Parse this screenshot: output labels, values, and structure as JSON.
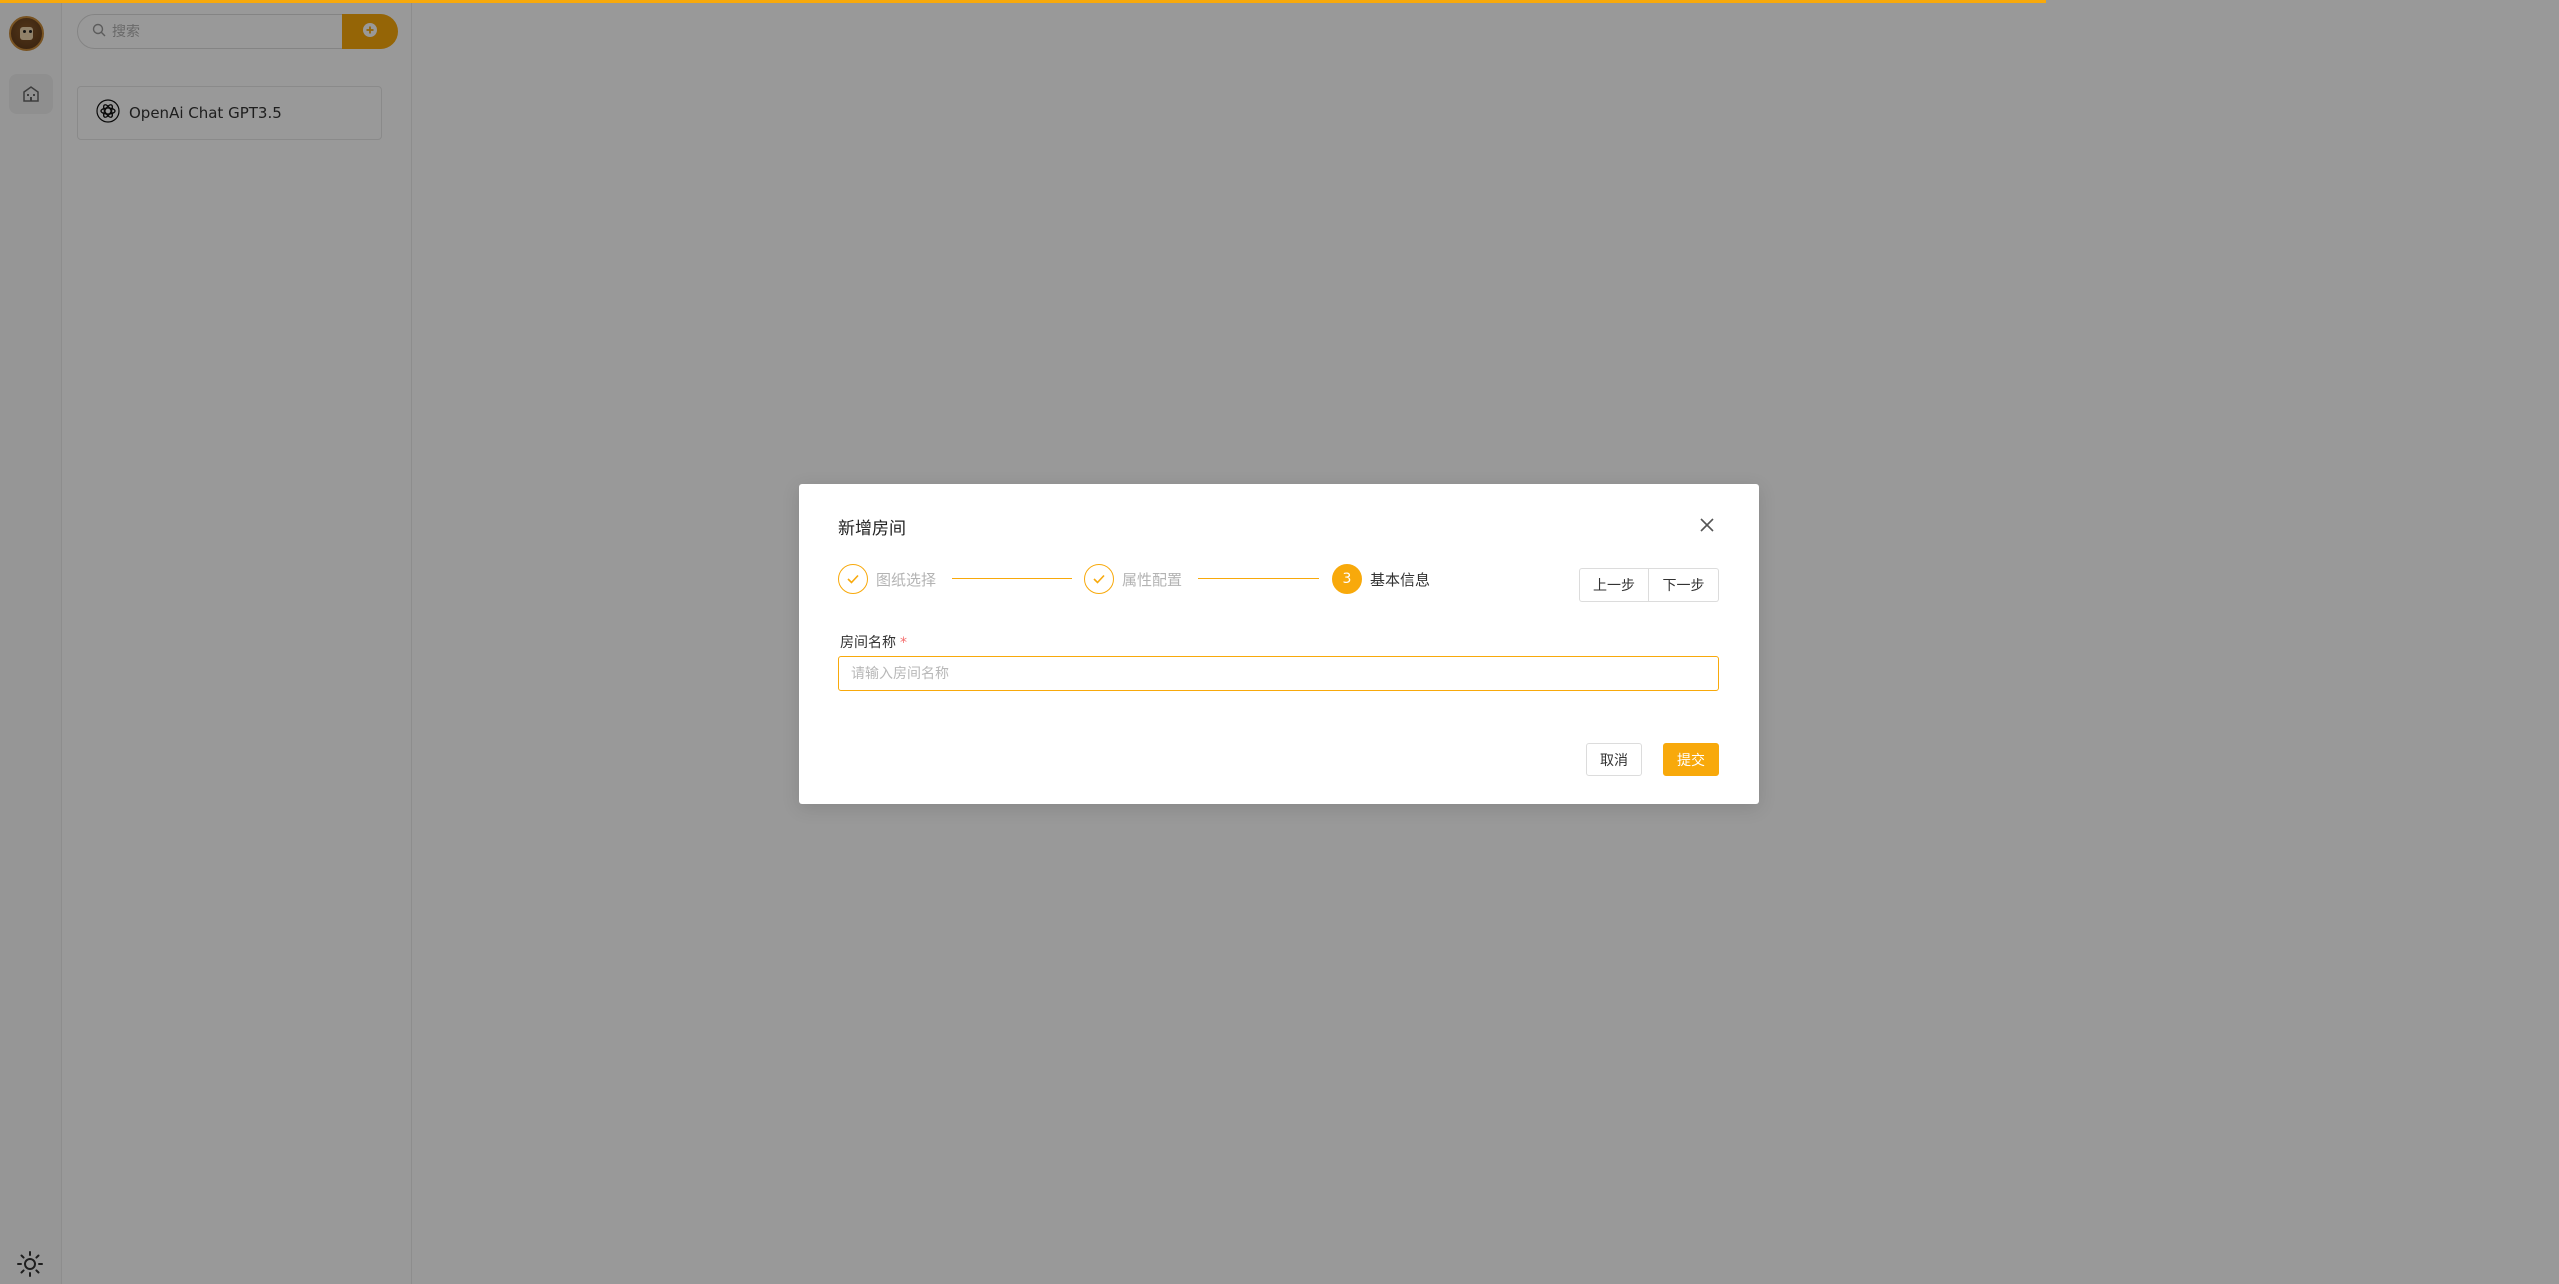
{
  "colors": {
    "accent": "#f8a90b",
    "required": "#f56c6c",
    "overlay": "rgba(0,0,0,0.40)"
  },
  "sidebar": {
    "avatar_icon": "user-avatar-icon",
    "home_icon": "building-icon",
    "theme_icon": "sun-icon"
  },
  "list_panel": {
    "search": {
      "placeholder": "搜索",
      "icon": "search-icon"
    },
    "add_button_icon": "plus-circle-icon",
    "items": [
      {
        "label": "OpenAi Chat GPT3.5",
        "icon": "openai-icon"
      }
    ]
  },
  "modal": {
    "title": "新增房间",
    "close_icon": "close-icon",
    "steps": [
      {
        "label": "图纸选择",
        "status": "done",
        "icon": "check-icon"
      },
      {
        "label": "属性配置",
        "status": "done",
        "icon": "check-icon"
      },
      {
        "label": "基本信息",
        "status": "active",
        "number": "3"
      }
    ],
    "prev_label": "上一步",
    "next_label": "下一步",
    "form": {
      "room_name_label": "房间名称",
      "required_mark": "*",
      "room_name_placeholder": "请输入房间名称",
      "room_name_value": ""
    },
    "cancel_label": "取消",
    "submit_label": "提交"
  }
}
